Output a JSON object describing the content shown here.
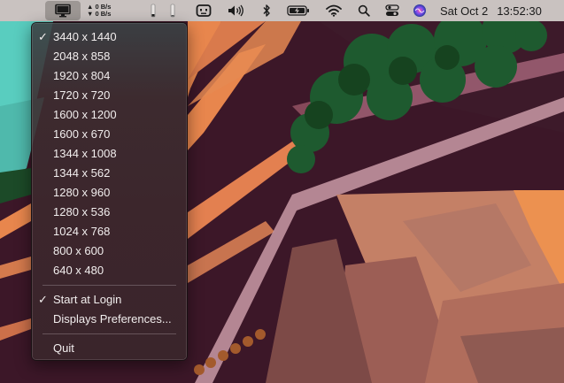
{
  "menubar": {
    "display_icon": "display-monitor-icon",
    "net_up": "▲ 0 B/s",
    "net_down": "▼ 0 B/s",
    "icons": [
      "usage-bar-icon",
      "usage-bar-icon",
      "runcat-icon",
      "volume-icon",
      "bluetooth-icon",
      "battery-charging-icon",
      "wifi-icon",
      "spotlight-search-icon",
      "control-center-icon",
      "siri-icon"
    ],
    "date": "Sat Oct 2",
    "time": "13:52:30"
  },
  "menu": {
    "resolutions": [
      {
        "label": "3440 x 1440",
        "checked": true
      },
      {
        "label": "2048 x 858",
        "checked": false
      },
      {
        "label": "1920 x 804",
        "checked": false
      },
      {
        "label": "1720 x 720",
        "checked": false
      },
      {
        "label": "1600 x 1200",
        "checked": false
      },
      {
        "label": "1600 x 670",
        "checked": false
      },
      {
        "label": "1344 x 1008",
        "checked": false
      },
      {
        "label": "1344 x 562",
        "checked": false
      },
      {
        "label": "1280 x 960",
        "checked": false
      },
      {
        "label": "1280 x 536",
        "checked": false
      },
      {
        "label": "1024 x 768",
        "checked": false
      },
      {
        "label": "800 x 600",
        "checked": false
      },
      {
        "label": "640 x 480",
        "checked": false
      }
    ],
    "check_mark": "✓",
    "start_at_login": {
      "label": "Start at Login",
      "checked": true
    },
    "displays_preferences": "Displays Preferences...",
    "quit": "Quit"
  },
  "colors": {
    "menubar_bg": "#c9c2c0",
    "wallpaper_dark": "#3a1626",
    "wallpaper_orange": "#e8854c",
    "wallpaper_teal": "#5ccfc0",
    "foliage_green": "#1f5a30"
  }
}
